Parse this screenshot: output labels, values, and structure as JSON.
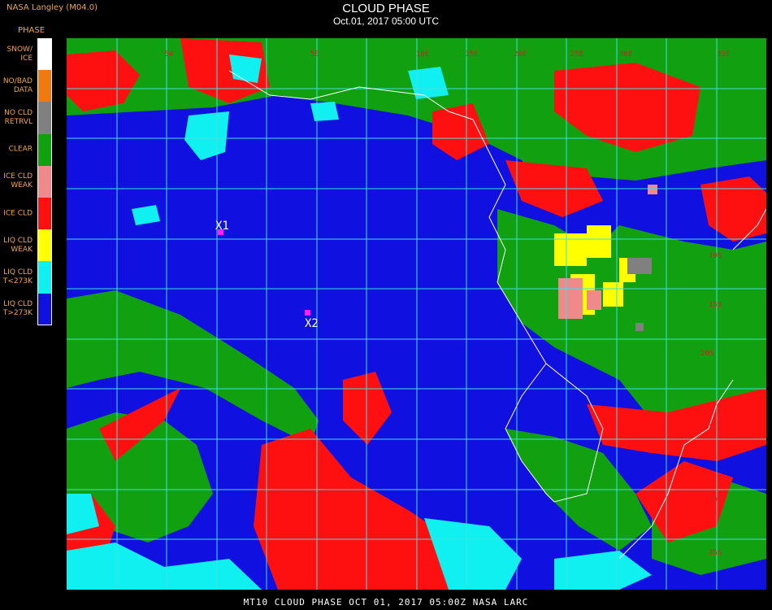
{
  "header": {
    "credit": "NASA Langley (M04.0)",
    "legend_title": "PHASE",
    "title": "CLOUD PHASE",
    "subtitle": "Oct.01, 2017 05:00 UTC"
  },
  "legend": [
    {
      "label": "SNOW/\nICE",
      "color": "#ffffff"
    },
    {
      "label": "NO/BAD\nDATA",
      "color": "#f07a10"
    },
    {
      "label": "NO CLD\nRETRVL",
      "color": "#808080"
    },
    {
      "label": "CLEAR",
      "color": "#10a010"
    },
    {
      "label": "ICE CLD\nWEAK",
      "color": "#f08a8a"
    },
    {
      "label": "ICE CLD",
      "color": "#ff1010"
    },
    {
      "label": "LIQ CLD\nWEAK",
      "color": "#ffff00"
    },
    {
      "label": "LIQ CLD\nT<273K",
      "color": "#10f0f0"
    },
    {
      "label": "LIQ CLD\nT>273K",
      "color": "#1010e0"
    }
  ],
  "markers": [
    {
      "label": "X1",
      "color": "#ff20ff"
    },
    {
      "label": "X2",
      "color": "#ff20ff"
    }
  ],
  "grid_labels": [
    "5W",
    "5E",
    "10E",
    "15E",
    "20E",
    "25E",
    "30E",
    "35E",
    "10S",
    "15S",
    "20S",
    "25S",
    "30S",
    "35S"
  ],
  "footer": {
    "caption": "MT10  CLOUD PHASE   OCT 01, 2017 05:00Z   NASA LARC"
  }
}
